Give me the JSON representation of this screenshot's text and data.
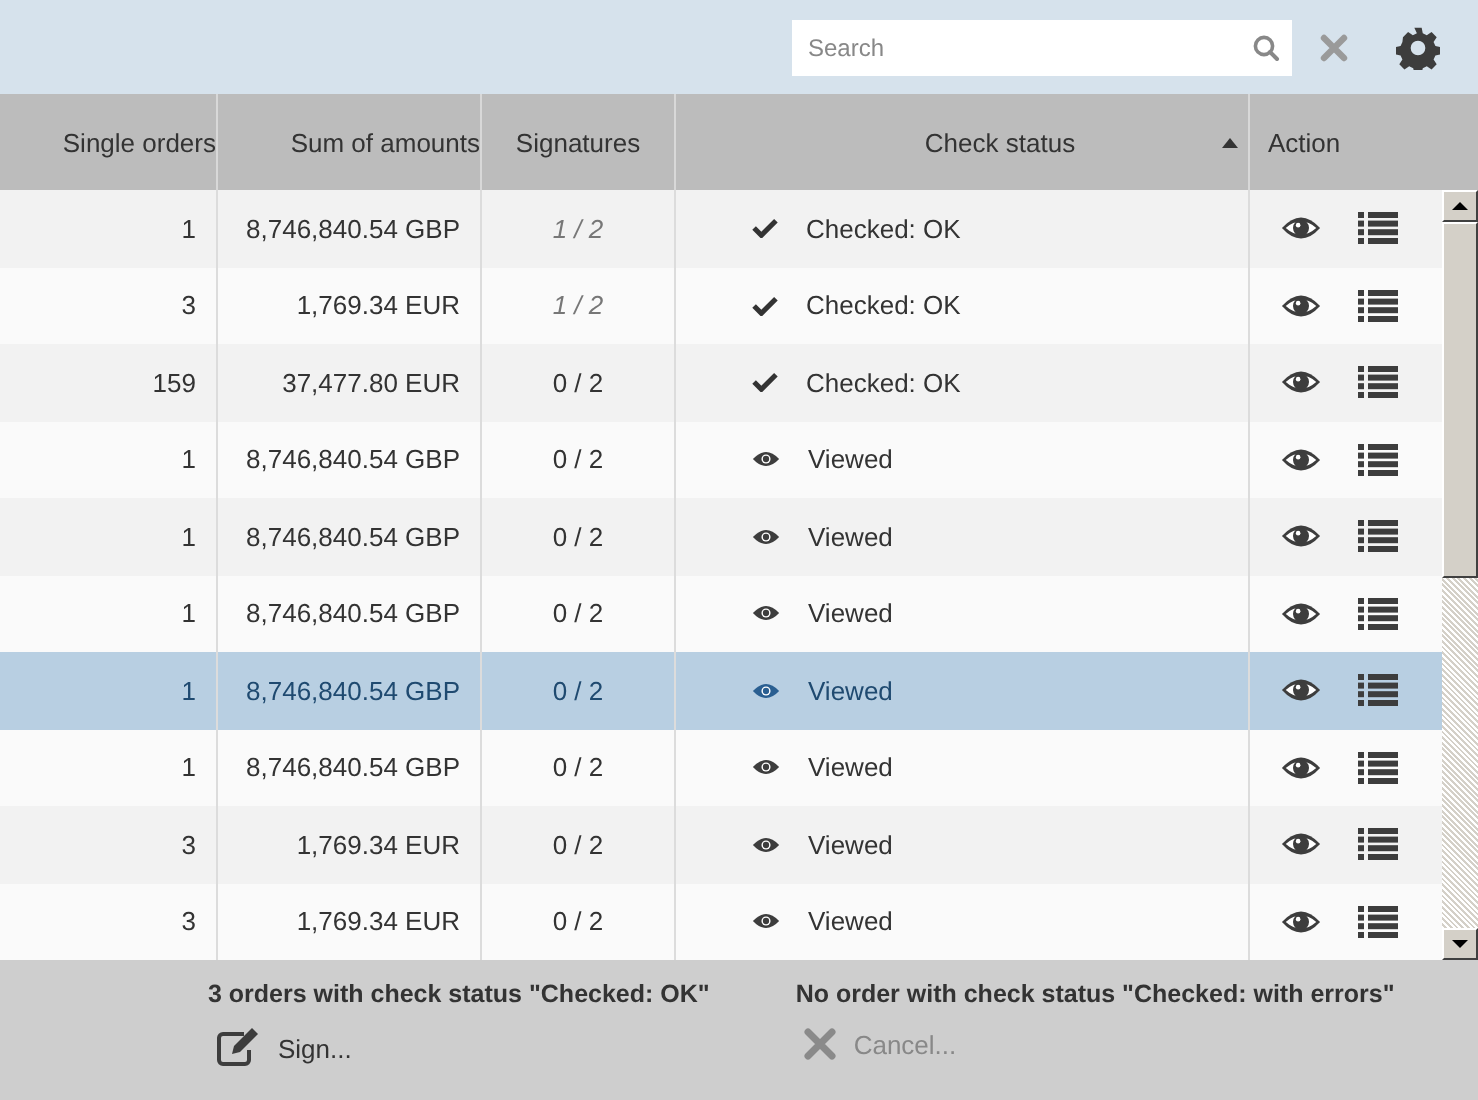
{
  "search": {
    "placeholder": "Search"
  },
  "columns": [
    {
      "label": "Single orders",
      "sorted": false
    },
    {
      "label": "Sum of amounts",
      "sorted": false
    },
    {
      "label": "Signatures",
      "sorted": false
    },
    {
      "label": "Check status",
      "sorted": true
    },
    {
      "label": "Action",
      "sorted": false
    }
  ],
  "rows": [
    {
      "orders": "1",
      "amount": "8,746,840.54 GBP",
      "signatures": "1 / 2",
      "partial": true,
      "kind": "checked",
      "status": "Checked: OK",
      "selected": false
    },
    {
      "orders": "3",
      "amount": "1,769.34 EUR",
      "signatures": "1 / 2",
      "partial": true,
      "kind": "checked",
      "status": "Checked: OK",
      "selected": false
    },
    {
      "orders": "159",
      "amount": "37,477.80 EUR",
      "signatures": "0 / 2",
      "partial": false,
      "kind": "checked",
      "status": "Checked: OK",
      "selected": false
    },
    {
      "orders": "1",
      "amount": "8,746,840.54 GBP",
      "signatures": "0 / 2",
      "partial": false,
      "kind": "viewed",
      "status": "Viewed",
      "selected": false
    },
    {
      "orders": "1",
      "amount": "8,746,840.54 GBP",
      "signatures": "0 / 2",
      "partial": false,
      "kind": "viewed",
      "status": "Viewed",
      "selected": false
    },
    {
      "orders": "1",
      "amount": "8,746,840.54 GBP",
      "signatures": "0 / 2",
      "partial": false,
      "kind": "viewed",
      "status": "Viewed",
      "selected": false
    },
    {
      "orders": "1",
      "amount": "8,746,840.54 GBP",
      "signatures": "0 / 2",
      "partial": false,
      "kind": "viewed",
      "status": "Viewed",
      "selected": true
    },
    {
      "orders": "1",
      "amount": "8,746,840.54 GBP",
      "signatures": "0 / 2",
      "partial": false,
      "kind": "viewed",
      "status": "Viewed",
      "selected": false
    },
    {
      "orders": "3",
      "amount": "1,769.34 EUR",
      "signatures": "0 / 2",
      "partial": false,
      "kind": "viewed",
      "status": "Viewed",
      "selected": false
    },
    {
      "orders": "3",
      "amount": "1,769.34 EUR",
      "signatures": "0 / 2",
      "partial": false,
      "kind": "viewed",
      "status": "Viewed",
      "selected": false
    }
  ],
  "footer": [
    {
      "summary": "3 orders with check status \"Checked: OK\"",
      "action": {
        "kind": "sign",
        "label": "Sign...",
        "disabled": false
      }
    },
    {
      "summary": "No order with check status \"Checked: with errors\"",
      "action": {
        "kind": "cancel",
        "label": "Cancel...",
        "disabled": true
      }
    }
  ]
}
